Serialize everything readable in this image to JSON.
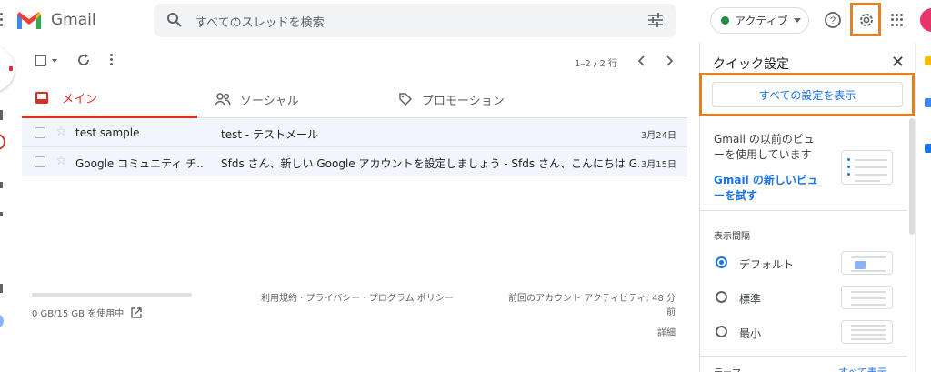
{
  "header": {
    "app_name": "Gmail",
    "search_placeholder": "すべてのスレッドを検索",
    "status": "アクティブ",
    "colors": {
      "brand_red": "#d93025",
      "status_green": "#1e8e3e",
      "highlight": "#e67e22"
    }
  },
  "toolbar": {
    "pager": "1–2 / 2 行"
  },
  "tabs": [
    {
      "label": "メイン",
      "icon": "inbox-icon",
      "active": true
    },
    {
      "label": "ソーシャル",
      "icon": "people-icon",
      "active": false
    },
    {
      "label": "プロモーション",
      "icon": "tag-icon",
      "active": false
    }
  ],
  "emails": [
    {
      "sender": "test sample",
      "subject": "test - テストメール",
      "date": "3月24日"
    },
    {
      "sender": "Google コミュニティ チ...",
      "subject": "Sfds さん、新しい Google アカウントを設定しましょう - Sfds さん、こんにちは G...",
      "date": "3月15日"
    }
  ],
  "footer": {
    "storage": "0 GB/15 GB を使用中",
    "links": "利用規約 · プライバシー · プログラム ポリシー",
    "activity": "前回のアカウント アクティビティ: 48 分前",
    "details": "詳細"
  },
  "quick_settings": {
    "title": "クイック設定",
    "all_settings": "すべての設定を表示",
    "old_view_text": "Gmail の以前のビューを使用しています",
    "try_new_view": "Gmail の新しいビューを試す",
    "density_label": "表示間隔",
    "density_options": [
      {
        "label": "デフォルト",
        "selected": true
      },
      {
        "label": "標準",
        "selected": false
      },
      {
        "label": "最小",
        "selected": false
      }
    ],
    "theme_label": "テーマ",
    "theme_all": "すべて表示"
  }
}
